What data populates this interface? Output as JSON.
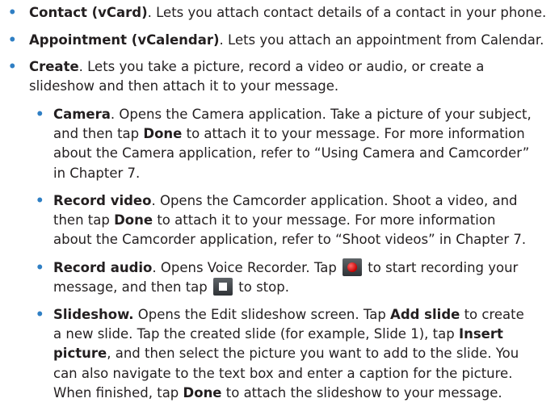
{
  "bullet_glyph": "•",
  "colors": {
    "bullet": "#2f7fc4",
    "text": "#231f20",
    "record_icon": "#c40000"
  },
  "items": [
    {
      "term": "Contact (vCard)",
      "desc": ". Lets you attach contact details of a contact in your phone."
    },
    {
      "term": "Appointment (vCalendar)",
      "desc": ". Lets you attach an appointment from Calendar."
    },
    {
      "term": "Create",
      "desc_line1": ". Lets you take a picture, record a video or audio, or create a",
      "desc_line2": "slideshow and then attach it to your message."
    }
  ],
  "subitems": {
    "camera": {
      "term": "Camera",
      "l1": ". Opens the Camera application. Take a picture of your subject,",
      "l2_pre": "and then tap ",
      "l2_bold": "Done",
      "l2_post": " to attach it to your message. For more information",
      "l3": "about the Camera application, refer to “Using Camera and Camcorder”",
      "l4": "in Chapter 7."
    },
    "record_video": {
      "term": "Record video",
      "l1": ". Opens the Camcorder application. Shoot a video, and",
      "l2_pre": "then tap ",
      "l2_bold": "Done",
      "l2_post": " to attach it to your message. For more information",
      "l3": "about the Camcorder application, refer to “Shoot videos” in Chapter 7."
    },
    "record_audio": {
      "term": "Record audio",
      "l1_pre": ". Opens Voice Recorder. Tap ",
      "l1_post": " to start recording your",
      "l2_pre": "message, and then tap ",
      "l2_post": " to stop.",
      "record_icon": "record-icon",
      "stop_icon": "stop-icon"
    },
    "slideshow": {
      "term": "Slideshow.",
      "l1_pre": " Opens the Edit slideshow screen. Tap ",
      "l1_bold": "Add slide",
      "l1_post": " to create",
      "l2_pre": "a new slide. Tap the created slide (for example, Slide 1), tap ",
      "l2_bold": "Insert",
      "l3_bold": "picture",
      "l3_post": ", and then select the picture you want to add to the slide. You",
      "l4": "can also navigate to the text box and enter a caption for the picture.",
      "l5_pre": "When finished, tap ",
      "l5_bold": "Done",
      "l5_post": " to attach the slideshow to your message."
    }
  }
}
